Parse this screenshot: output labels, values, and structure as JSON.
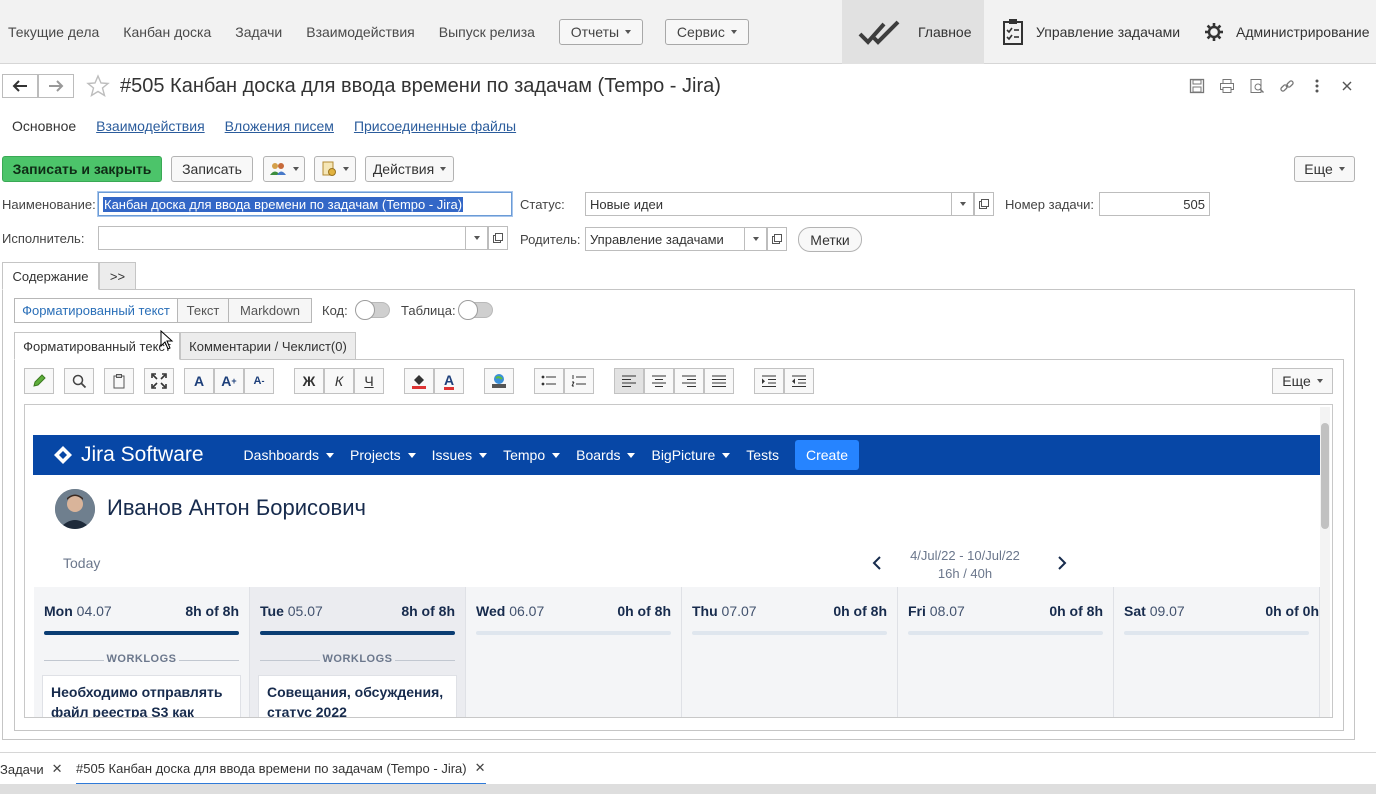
{
  "topmenu": {
    "items": [
      "Текущие дела",
      "Канбан доска",
      "Задачи",
      "Взаимодействия",
      "Выпуск релиза"
    ],
    "dropdowns": [
      "Отчеты",
      "Сервис"
    ]
  },
  "sections": {
    "main": "Главное",
    "tasks": "Управление задачами",
    "admin": "Администрирование"
  },
  "document": {
    "title": "#505 Канбан доска для ввода времени по задачам (Tempo - Jira)"
  },
  "subtabs": [
    "Основное",
    "Взаимодействия",
    "Вложения писем",
    "Присоединенные файлы"
  ],
  "commands": {
    "save_close": "Записать и закрыть",
    "save": "Записать",
    "actions": "Действия",
    "more": "Еще"
  },
  "fields": {
    "name_label": "Наименование:",
    "name_value": "Канбан доска для ввода времени по задачам (Tempo - Jira)",
    "status_label": "Статус:",
    "status_value": "Новые идеи",
    "task_number_label": "Номер задачи:",
    "task_number_value": "505",
    "assignee_label": "Исполнитель:",
    "assignee_value": "",
    "parent_label": "Родитель:",
    "parent_value": "Управление задачами",
    "tags_button": "Метки"
  },
  "content_tabs": [
    "Содержание",
    ">>"
  ],
  "format_modes": [
    "Форматированный текст",
    "Текст",
    "Markdown"
  ],
  "toggles": {
    "code_label": "Код:",
    "table_label": "Таблица:"
  },
  "inner_tabs": [
    "Форматированный текст",
    "Комментарии / Чеклист(0)"
  ],
  "editor_toolbar": {
    "bold": "Ж",
    "italic": "К",
    "underline": "Ч",
    "font_a": "A",
    "more": "Еще"
  },
  "jira": {
    "logo": "Jira Software",
    "nav": [
      "Dashboards",
      "Projects",
      "Issues",
      "Tempo",
      "Boards",
      "BigPicture"
    ],
    "tests": "Tests",
    "create": "Create",
    "user_name": "Иванов Антон Борисович",
    "today": "Today",
    "range": "4/Jul/22 - 10/Jul/22",
    "total": "16h / 40h",
    "worklogs_label": "WORKLOGS",
    "days": [
      {
        "dow": "Mon",
        "date": "04.07",
        "hours": "8h of 8h",
        "fill": 1.0,
        "card": "Необходимо отправлять файл реестра S3 как"
      },
      {
        "dow": "Tue",
        "date": "05.07",
        "hours": "8h of 8h",
        "fill": 1.0,
        "card": "Совещания, обсуждения, статус 2022"
      },
      {
        "dow": "Wed",
        "date": "06.07",
        "hours": "0h of 8h",
        "fill": 0
      },
      {
        "dow": "Thu",
        "date": "07.07",
        "hours": "0h of 8h",
        "fill": 0
      },
      {
        "dow": "Fri",
        "date": "08.07",
        "hours": "0h of 8h",
        "fill": 0
      },
      {
        "dow": "Sat",
        "date": "09.07",
        "hours": "0h of 0h",
        "fill": 0
      }
    ]
  },
  "windows": {
    "tab1": "Задачи",
    "tab2": "#505 Канбан доска для ввода времени по задачам (Tempo - Jira)"
  },
  "colors": {
    "primary_button": "#4cc46a",
    "jira_nav": "#0747a6",
    "jira_create": "#2684ff",
    "link": "#2b5c9c"
  }
}
